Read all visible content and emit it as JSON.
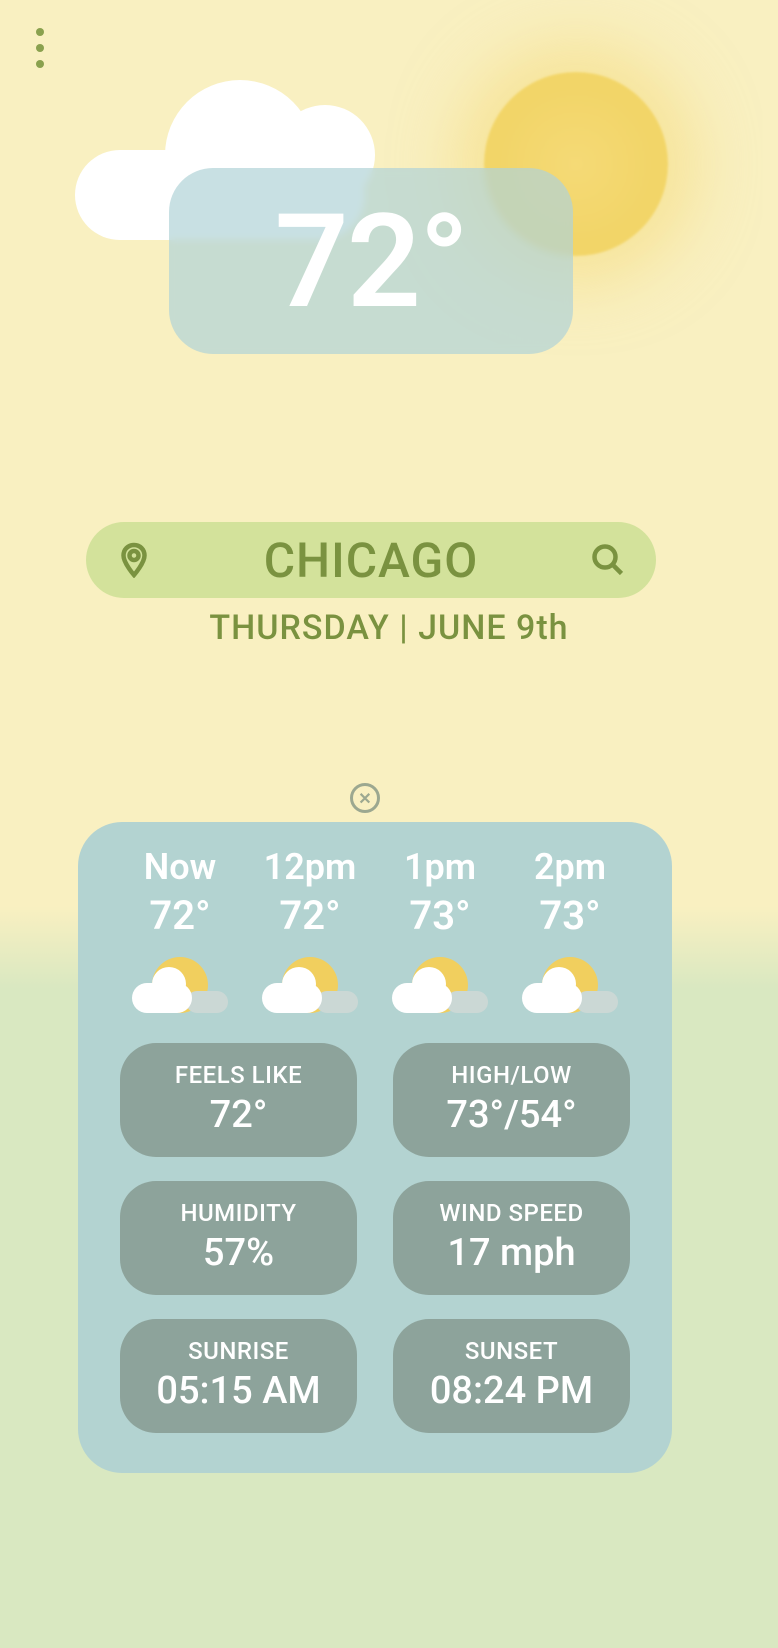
{
  "current_temp": "72°",
  "location": "CHICAGO",
  "date_line": "THURSDAY | JUNE 9th",
  "close_glyph": "✕",
  "hourly": [
    {
      "label": "Now",
      "temp": "72°"
    },
    {
      "label": "12pm",
      "temp": "72°"
    },
    {
      "label": "1pm",
      "temp": "73°"
    },
    {
      "label": "2pm",
      "temp": "73°"
    }
  ],
  "stats": {
    "feels_like": {
      "label": "FEELS LIKE",
      "value": "72°"
    },
    "high_low": {
      "label": "HIGH/LOW",
      "value": "73°/54°"
    },
    "humidity": {
      "label": "HUMIDITY",
      "value": "57%"
    },
    "wind_speed": {
      "label": "WIND SPEED",
      "value": "17 mph"
    },
    "sunrise": {
      "label": "SUNRISE",
      "value": "05:15 AM"
    },
    "sunset": {
      "label": "SUNSET",
      "value": "08:24 PM"
    }
  }
}
